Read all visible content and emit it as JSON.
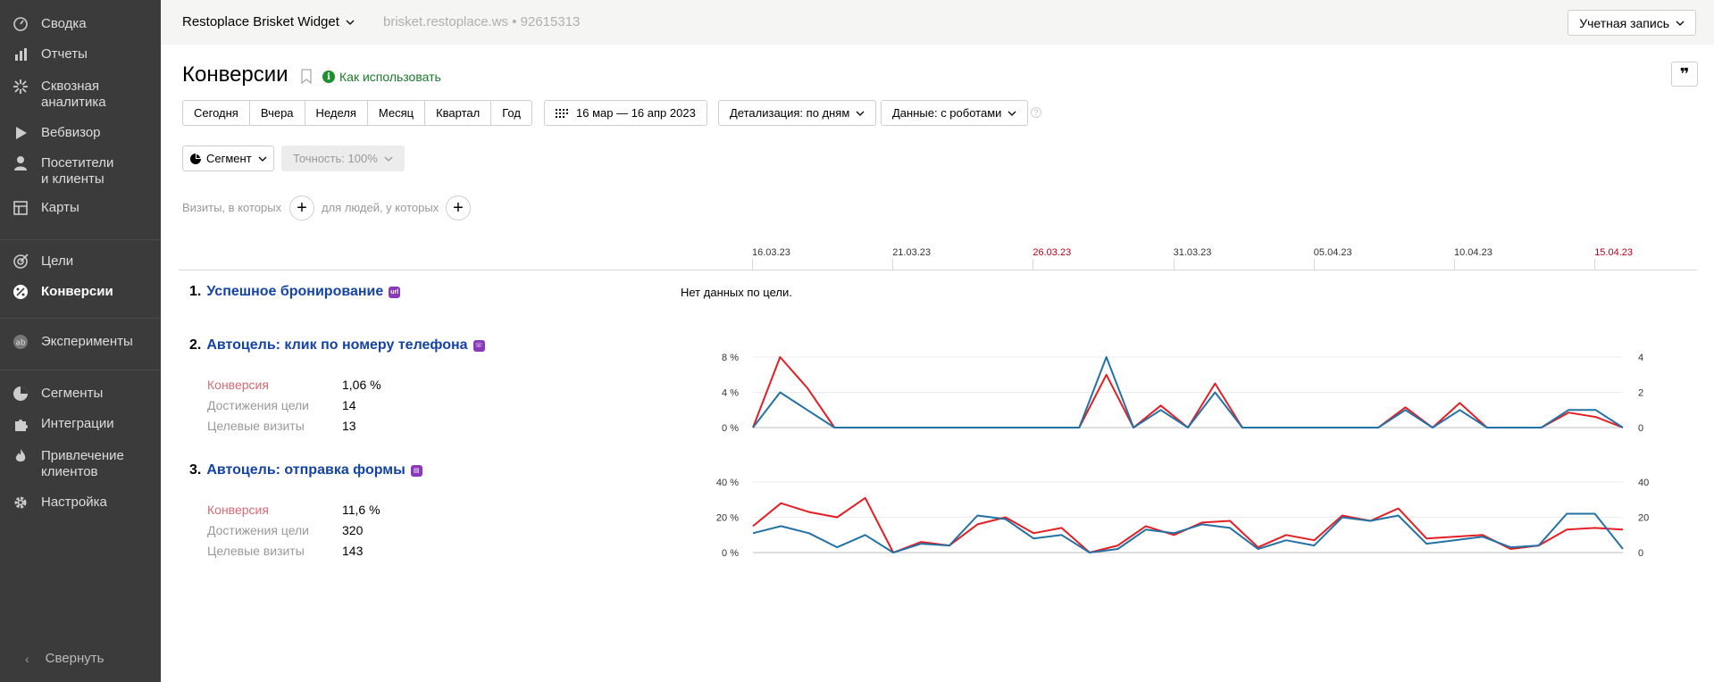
{
  "sidebar": {
    "items": [
      {
        "label": "Сводка",
        "icon": "gauge-icon"
      },
      {
        "label": "Отчеты",
        "icon": "bar-chart-icon"
      },
      {
        "label": "Сквозная\nаналитика",
        "icon": "sparkle-icon"
      },
      {
        "label": "Вебвизор",
        "icon": "play-icon"
      },
      {
        "label": "Посетители\nи клиенты",
        "icon": "person-icon"
      },
      {
        "label": "Карты",
        "icon": "map-icon"
      },
      {
        "label": "Цели",
        "icon": "target-icon"
      },
      {
        "label": "Конверсии",
        "icon": "percent-icon",
        "active": true
      },
      {
        "label": "Эксперименты",
        "icon": "ab-icon"
      },
      {
        "label": "Сегменты",
        "icon": "pie-icon"
      },
      {
        "label": "Интеграции",
        "icon": "puzzle-icon"
      },
      {
        "label": "Привлечение\nклиентов",
        "icon": "flame-icon"
      },
      {
        "label": "Настройка",
        "icon": "gear-icon"
      }
    ],
    "collapse_label": "Свернуть"
  },
  "topbar": {
    "counter_name": "Restoplace Brisket Widget",
    "counter_meta": "brisket.restoplace.ws • 92615313",
    "account_label": "Учетная запись"
  },
  "header": {
    "title": "Конверсии",
    "howto_label": "Как использовать"
  },
  "toolbar": {
    "periods": [
      "Сегодня",
      "Вчера",
      "Неделя",
      "Месяц",
      "Квартал",
      "Год"
    ],
    "date_range": "16 мар — 16 апр 2023",
    "detail": "Детализация: по дням",
    "data": "Данные: с роботами",
    "segment": "Сегмент",
    "accuracy": "Точность: 100%"
  },
  "filters": {
    "visits_label": "Визиты, в которых",
    "people_label": "для людей, у которых"
  },
  "timeline": {
    "dates": [
      {
        "label": "16.03.23",
        "red": false
      },
      {
        "label": "21.03.23",
        "red": false
      },
      {
        "label": "26.03.23",
        "red": true
      },
      {
        "label": "31.03.23",
        "red": false
      },
      {
        "label": "05.04.23",
        "red": false
      },
      {
        "label": "10.04.23",
        "red": false
      },
      {
        "label": "15.04.23",
        "red": true
      }
    ]
  },
  "goals": [
    {
      "num": "1.",
      "name": "Успешное бронирование",
      "badge": "url",
      "nodata": "Нет данных по цели."
    },
    {
      "num": "2.",
      "name": "Автоцель: клик по номеру телефона",
      "badge": "phone",
      "metrics": [
        {
          "label": "Конверсия",
          "value": "1,06 %"
        },
        {
          "label": "Достижения цели",
          "value": "14"
        },
        {
          "label": "Целевые визиты",
          "value": "13"
        }
      ]
    },
    {
      "num": "3.",
      "name": "Автоцель: отправка формы",
      "badge": "form",
      "metrics": [
        {
          "label": "Конверсия",
          "value": "11,6 %"
        },
        {
          "label": "Достижения цели",
          "value": "320"
        },
        {
          "label": "Целевые визиты",
          "value": "143"
        }
      ]
    }
  ],
  "chart_data": [
    {
      "type": "line",
      "x_start": "16.03.23",
      "x_end": "16.04.23",
      "left_axis": {
        "ticks": [
          "0 %",
          "4 %",
          "8 %"
        ],
        "range": [
          0,
          8
        ]
      },
      "right_axis": {
        "ticks": [
          "0",
          "2",
          "4"
        ],
        "range": [
          0,
          4
        ]
      },
      "colors": {
        "conversion": "#e31e24",
        "visits": "#2471a3"
      },
      "series": [
        {
          "values": [
            0,
            8,
            4.5,
            0,
            0,
            0,
            0,
            0,
            0,
            0,
            0,
            0,
            0,
            6,
            0,
            2.5,
            0,
            5,
            0,
            0,
            0,
            0,
            0,
            0,
            2.3,
            0,
            2.8,
            0,
            0,
            0,
            1.7,
            1.2,
            0
          ],
          "axis": "left"
        },
        {
          "values": [
            0,
            2,
            1,
            0,
            0,
            0,
            0,
            0,
            0,
            0,
            0,
            0,
            0,
            4,
            0,
            1,
            0,
            2,
            0,
            0,
            0,
            0,
            0,
            0,
            1,
            0,
            1,
            0,
            0,
            0,
            1,
            1,
            0
          ],
          "axis": "right"
        }
      ]
    },
    {
      "type": "line",
      "x_start": "16.03.23",
      "x_end": "16.04.23",
      "left_axis": {
        "ticks": [
          "0 %",
          "20 %",
          "40 %"
        ],
        "range": [
          0,
          40
        ]
      },
      "right_axis": {
        "ticks": [
          "0",
          "20",
          "40"
        ],
        "range": [
          0,
          40
        ]
      },
      "colors": {
        "conversion": "#e31e24",
        "visits": "#2471a3"
      },
      "series": [
        {
          "values": [
            15,
            28,
            23,
            20,
            31,
            0,
            6,
            4,
            16,
            20,
            11,
            14,
            0,
            4,
            15,
            10,
            17,
            18,
            3,
            10,
            7,
            21,
            18,
            25,
            8,
            9,
            10,
            2,
            4,
            13,
            14,
            13
          ],
          "axis": "left"
        },
        {
          "values": [
            11,
            15,
            11,
            3,
            10,
            0,
            5,
            4,
            21,
            19,
            8,
            10,
            0,
            2,
            13,
            11,
            16,
            14,
            2,
            7,
            4,
            20,
            18,
            21,
            5,
            7,
            9,
            3,
            4,
            22,
            22,
            2
          ],
          "axis": "right"
        }
      ]
    }
  ]
}
